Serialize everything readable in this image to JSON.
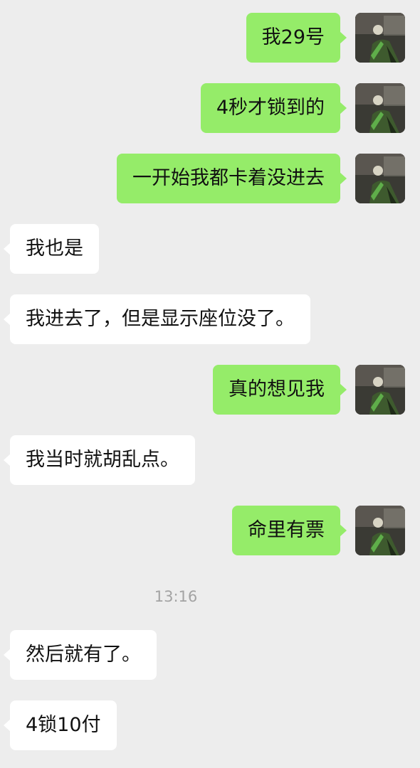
{
  "messages": [
    {
      "side": "out",
      "text": "我29号"
    },
    {
      "side": "out",
      "text": "4秒才锁到的"
    },
    {
      "side": "out",
      "text": "一开始我都卡着没进去"
    },
    {
      "side": "in",
      "text": "我也是"
    },
    {
      "side": "in",
      "text": "我进去了，但是显示座位没了。"
    },
    {
      "side": "out",
      "text": "真的想见我"
    },
    {
      "side": "in",
      "text": "我当时就胡乱点。"
    },
    {
      "side": "out",
      "text": "命里有票"
    },
    {
      "side": "in",
      "text": "然后就有了。"
    },
    {
      "side": "in",
      "text": "4锁10付"
    }
  ],
  "timestamp": "13:16",
  "colors": {
    "background": "#ededed",
    "outgoing_bubble": "#95ec69",
    "incoming_bubble": "#ffffff",
    "text": "#111111",
    "timestamp": "#a3a3a3"
  },
  "avatar_icon": "user-avatar-photo"
}
